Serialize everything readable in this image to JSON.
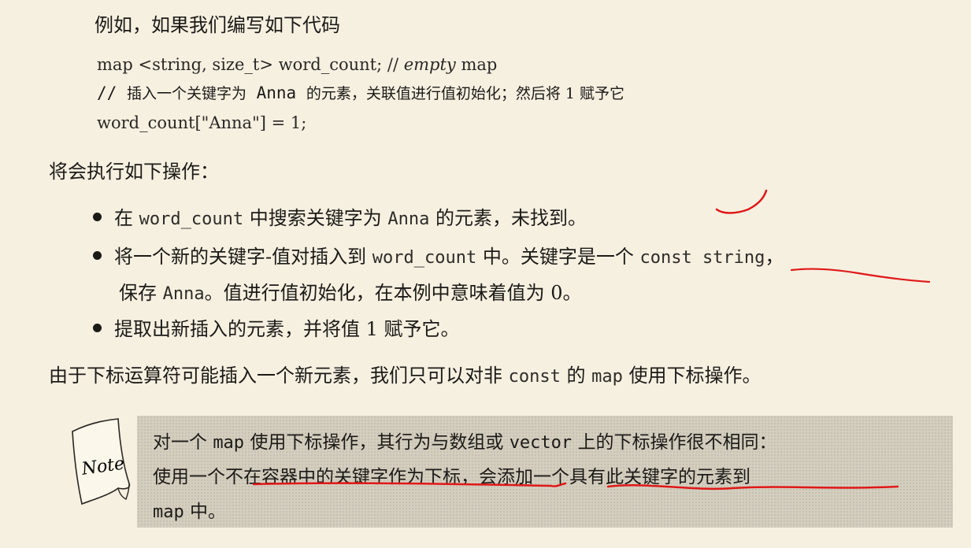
{
  "intro": "例如，如果我们编写如下代码",
  "code": {
    "line1_a": "map <string, size_t> word_count; // ",
    "line1_em": "empty",
    "line1_b": " map",
    "line2_a": "// ",
    "line2_zh1": "插入一个关键字为",
    "line2_code": " Anna ",
    "line2_zh2": "的元素，关联值进行值初始化；然后将 1 赋予它",
    "line3": "word_count[\"Anna\"] = 1;"
  },
  "ops_intro": "将会执行如下操作：",
  "bullets": [
    {
      "t1": "在 ",
      "c1": "word_count",
      "t2": " 中搜索关键字为 ",
      "c2": "Anna",
      "t3": " 的元素，未找到。"
    },
    {
      "t1": "将一个新的关键字-值对插入到 ",
      "c1": "word_count",
      "t2": " 中。关键字是一个 ",
      "c2": "const string",
      "t3": "，"
    },
    {
      "t1": "保存 ",
      "c1": "Anna",
      "t2": "。值进行值初始化，在本例中意味着值为 0。"
    },
    {
      "t1": "提取出新插入的元素，并将值 1 赋予它。"
    }
  ],
  "summary": {
    "t1": "由于下标运算符可能插入一个新元素，我们只可以对非 ",
    "c1": "const",
    "t2": " 的 ",
    "c2": "map",
    "t3": " 使用下标操作。"
  },
  "note": {
    "label": "Note",
    "l1_a": "对一个 ",
    "l1_c1": "map",
    "l1_b": " 使用下标操作，其行为与数组或 ",
    "l1_c2": "vector",
    "l1_c": " 上的下标操作很不相同：",
    "l2": "使用一个不在容器中的关键字作为下标，会添加一个具有此关键字的元素到",
    "l3_c": "map",
    "l3_t": " 中。"
  },
  "colors": {
    "page": "#f6f0e1",
    "note_bg": "#d4cebf",
    "annotation": "#e01818"
  }
}
